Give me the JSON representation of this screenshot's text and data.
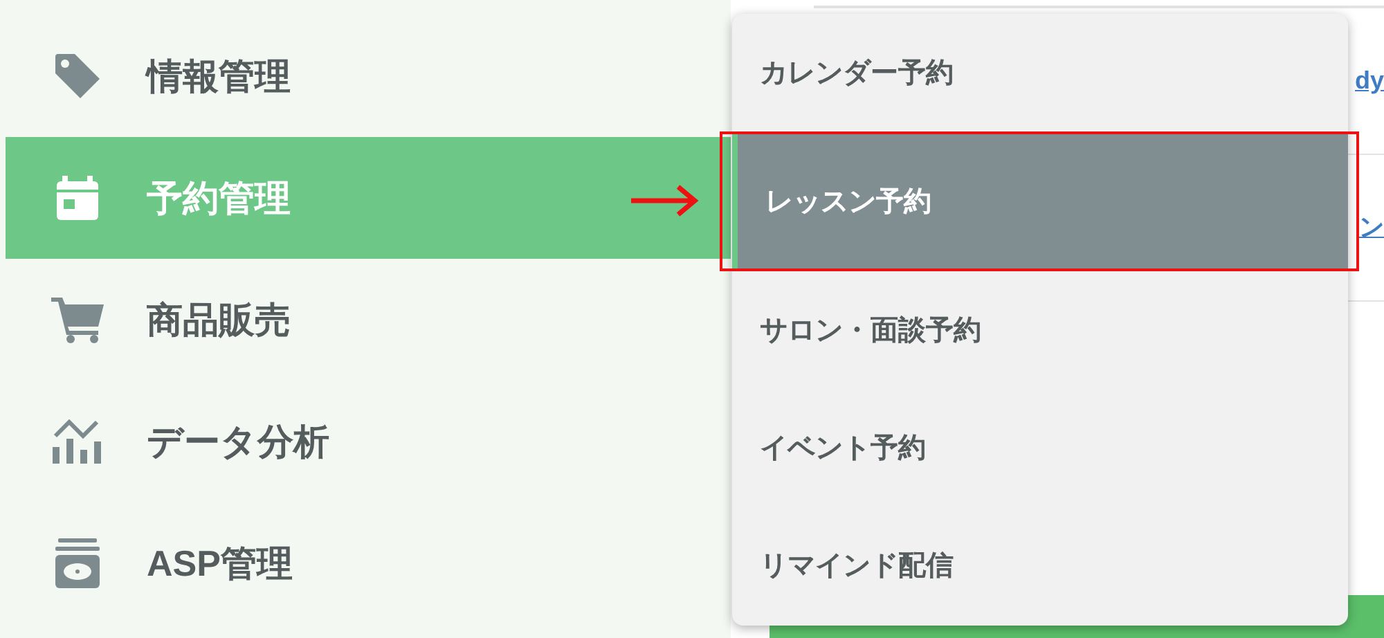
{
  "sidebar": {
    "items": [
      {
        "label": "情報管理",
        "selected": false
      },
      {
        "label": "予約管理",
        "selected": true
      },
      {
        "label": "商品販売",
        "selected": false
      },
      {
        "label": "データ分析",
        "selected": false
      },
      {
        "label": "ASP管理",
        "selected": false
      }
    ]
  },
  "content": {
    "links": [
      "dy",
      "ン"
    ]
  },
  "dropdown": {
    "items": [
      {
        "label": "カレンダー予約",
        "selected": false
      },
      {
        "label": "レッスン予約",
        "selected": true
      },
      {
        "label": "サロン・面談予約",
        "selected": false
      },
      {
        "label": "イベント予約",
        "selected": false
      },
      {
        "label": "リマインド配信",
        "selected": false
      }
    ]
  }
}
